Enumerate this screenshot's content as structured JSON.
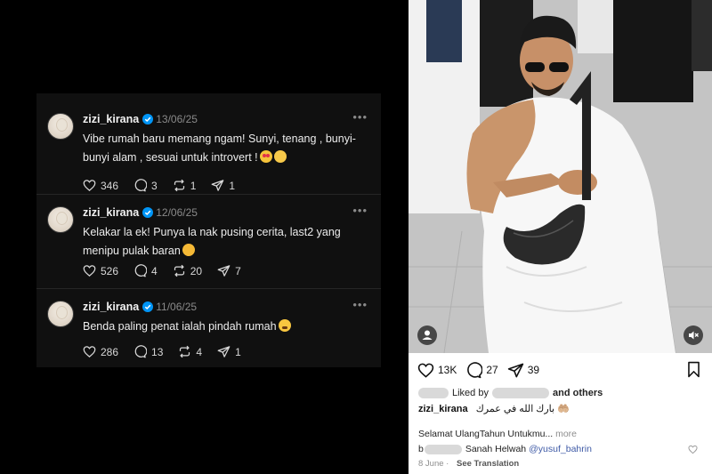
{
  "threads": {
    "posts": [
      {
        "username": "zizi_kirana",
        "date": "13/06/25",
        "text": "Vibe rumah baru memang ngam! Sunyi, tenang , bunyi-bunyi alam , sesuai untuk introvert !",
        "likes": "346",
        "replies": "3",
        "reposts": "1",
        "shares": "1"
      },
      {
        "username": "zizi_kirana",
        "date": "12/06/25",
        "text": "Kelakar la ek! Punya la nak pusing cerita, last2 yang menipu pulak baran",
        "likes": "526",
        "replies": "4",
        "reposts": "20",
        "shares": "7"
      },
      {
        "username": "zizi_kirana",
        "date": "11/06/25",
        "text": "Benda paling penat ialah pindah rumah",
        "likes": "286",
        "replies": "13",
        "reposts": "4",
        "shares": "1"
      }
    ],
    "more_label": "•••"
  },
  "instagram": {
    "likes": "13K",
    "comments": "27",
    "shares": "39",
    "liked_by_prefix": "Liked by",
    "and_others": "and others",
    "caption_user": "zizi_kirana",
    "caption_text": "بارك الله في عمرك 🤲🏼",
    "caption2": "Selamat UlangTahun Untukmu...",
    "more_label": "more",
    "comment_prefix": "b",
    "comment_text": "Sanah Helwah",
    "comment_mention": "@yusuf_bahrin",
    "date": "8 June",
    "see_translation": "See Translation"
  },
  "colors": {
    "threads_bg": "#101010",
    "verified_blue": "#0095f6",
    "mention_blue": "#3e5aa6"
  }
}
